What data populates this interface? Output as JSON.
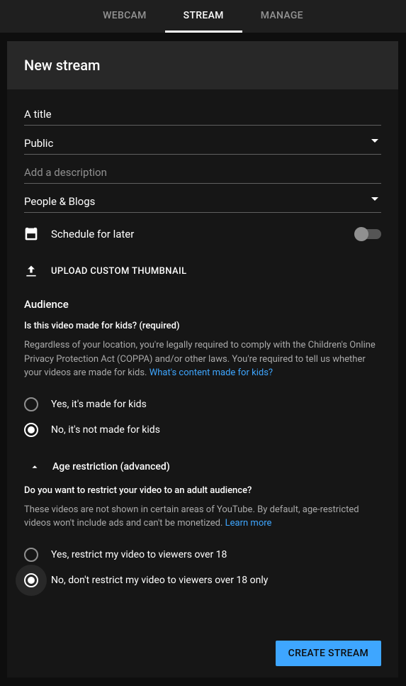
{
  "tabs": {
    "webcam": "WEBCAM",
    "stream": "STREAM",
    "manage": "MANAGE"
  },
  "header": {
    "title": "New stream"
  },
  "fields": {
    "title_value": "A title",
    "visibility_value": "Public",
    "description_placeholder": "Add a description",
    "category_value": "People & Blogs"
  },
  "schedule": {
    "label": "Schedule for later"
  },
  "upload": {
    "label": "UPLOAD CUSTOM THUMBNAIL"
  },
  "audience": {
    "heading": "Audience",
    "question": "Is this video made for kids? (required)",
    "para": "Regardless of your location, you're legally required to comply with the Children's Online Privacy Protection Act (COPPA) and/or other laws. You're required to tell us whether your videos are made for kids. ",
    "link": "What's content made for kids?",
    "yes": "Yes, it's made for kids",
    "no": "No, it's not made for kids"
  },
  "age": {
    "heading": "Age restriction (advanced)",
    "question": "Do you want to restrict your video to an adult audience?",
    "para": "These videos are not shown in certain areas of YouTube. By default, age-restricted videos won't include ads and can't be monetized. ",
    "link": "Learn more",
    "yes": "Yes, restrict my video to viewers over 18",
    "no": "No, don't restrict my video to viewers over 18 only"
  },
  "footer": {
    "create": "CREATE STREAM"
  }
}
